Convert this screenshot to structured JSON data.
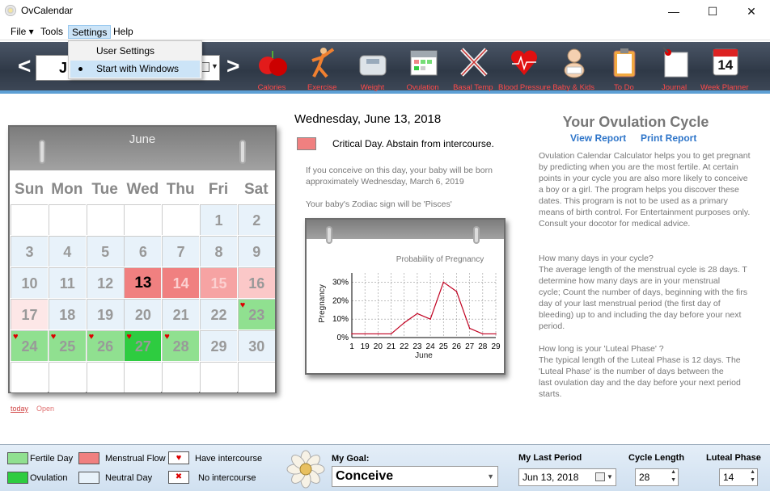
{
  "window": {
    "title": "OvCalendar",
    "minimize": "—",
    "maximize": "☐",
    "close": "✕"
  },
  "menu": {
    "file": "File ▾",
    "tools": "Tools",
    "settings": "Settings",
    "help": "Help"
  },
  "settings_menu": {
    "user_settings": "User Settings",
    "start_with_windows": "Start with Windows"
  },
  "toolbar": {
    "prev": "<",
    "next": ">",
    "date_fragment": "J",
    "items": [
      {
        "label": "Calories",
        "icon": "apples-icon"
      },
      {
        "label": "Exercise",
        "icon": "exercise-icon"
      },
      {
        "label": "Weight",
        "icon": "scale-icon"
      },
      {
        "label": "Ovulation",
        "icon": "ovulation-calendar-icon"
      },
      {
        "label": "Basal Temp",
        "icon": "thermometer-icon"
      },
      {
        "label": "Blood Pressure",
        "icon": "heart-icon"
      },
      {
        "label": "Baby & Kids",
        "icon": "baby-icon"
      },
      {
        "label": "To Do",
        "icon": "clipboard-icon"
      },
      {
        "label": "Journal",
        "icon": "journal-icon"
      },
      {
        "label": "Week Planner",
        "icon": "week-planner-icon",
        "badge": "14"
      }
    ]
  },
  "calendar": {
    "month": "June",
    "days_of_week": [
      "Sun",
      "Mon",
      "Tue",
      "Wed",
      "Thu",
      "Fri",
      "Sat"
    ],
    "weeks": [
      [
        "",
        "",
        "",
        "",
        "",
        "1",
        "2"
      ],
      [
        "3",
        "4",
        "5",
        "6",
        "7",
        "8",
        "9"
      ],
      [
        "10",
        "11",
        "12",
        "13",
        "14",
        "15",
        "16"
      ],
      [
        "17",
        "18",
        "19",
        "20",
        "21",
        "22",
        "23"
      ],
      [
        "24",
        "25",
        "26",
        "27",
        "28",
        "29",
        "30"
      ],
      [
        "",
        "",
        "",
        "",
        "",
        "",
        ""
      ]
    ],
    "today_link": "today",
    "open_link": "Open"
  },
  "middle": {
    "date_title": "Wednesday, June 13, 2018",
    "critical": "Critical Day. Abstain from intercourse.",
    "born_line1": "If you conceive on this day, your baby will be born",
    "born_line2": "approximately Wednesday, March 6, 2019",
    "zodiac": "Your baby's Zodiac sign will be 'Pisces'"
  },
  "chart_data": {
    "type": "line",
    "title": "Probability of Pregnancy",
    "xlabel": "June",
    "ylabel": "Pregnancy",
    "x": [
      "1",
      "19",
      "20",
      "21",
      "22",
      "23",
      "24",
      "25",
      "26",
      "27",
      "28",
      "29"
    ],
    "values": [
      2,
      2,
      2,
      2,
      8,
      13,
      10,
      30,
      25,
      5,
      2,
      2
    ],
    "yticks": [
      "30%",
      "20%",
      "10%",
      "0%"
    ],
    "ylim": [
      0,
      35
    ],
    "grid": true
  },
  "right": {
    "title": "Your Ovulation Cycle",
    "view_report": "View Report",
    "print_report": "Print Report",
    "para1": [
      "Ovulation Calendar Calculator helps you to get pregnant",
      "by predicting when you are the most fertile. At certain",
      "points in your cycle you are also more likely to conceive",
      "a boy or a girl. The program helps you discover these",
      "dates. This program is not to be used as a primary",
      "means of birth control. For Entertainment purposes only.",
      "Consult your docotor for medical advice."
    ],
    "para2": [
      "How many days in your cycle?",
      "The average length of the menstrual cycle is 28 days. T",
      "determine how many days are in your menstrual",
      "cycle; Count the number of days, beginning with the firs",
      "day of your last menstrual period (the first day of",
      "bleeding) up to and including the day before your next",
      "period."
    ],
    "para3": [
      "How long is your 'Luteal Phase' ?",
      "The typical length of the Luteal Phase is 12 days. The",
      "'Luteal Phase' is the number of days between the",
      "last ovulation day and the day before your next period",
      "starts."
    ]
  },
  "legend": {
    "fertile": "Fertile Day",
    "ovulation": "Ovulation",
    "menstrual": "Menstrual Flow",
    "neutral": "Neutral Day",
    "intercourse": "Have intercourse",
    "no_intercourse": "No intercourse"
  },
  "bottom": {
    "goal_label": "My Goal:",
    "goal_value": "Conceive",
    "last_period_label": "My Last Period",
    "last_period_value": "Jun 13, 2018",
    "cycle_label": "Cycle Length",
    "cycle_value": "28",
    "luteal_label": "Luteal Phase",
    "luteal_value": "14"
  },
  "colors": {
    "fertile": "#90e090",
    "ovulation": "#2ecc40",
    "menstrual": "#f08080",
    "neutral": "#e8f2fa",
    "accent": "#2e75c9"
  }
}
